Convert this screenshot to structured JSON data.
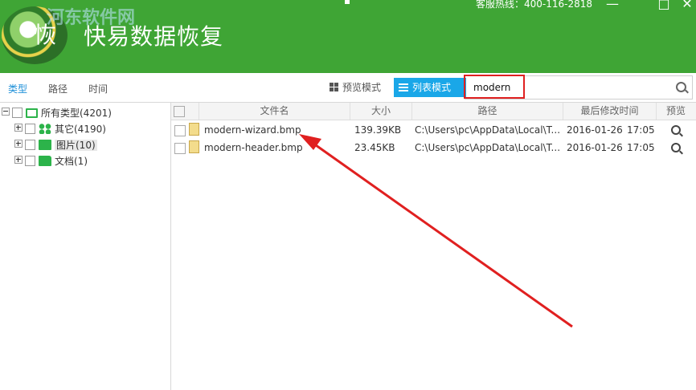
{
  "app": {
    "logo_text": "恢",
    "title": "快易数据恢复",
    "watermark": "河东软件网",
    "hotline": "客服热线：400-116-2818",
    "window_controls": [
      "—",
      "□",
      "✕"
    ]
  },
  "toolbar": {
    "tabs": [
      "类型",
      "路径",
      "时间"
    ],
    "preview_mode_label": "预览模式",
    "list_mode_label": "列表模式",
    "search_value": "modern"
  },
  "tree": {
    "root": "所有类型(4201)",
    "children": [
      "其它(4190)",
      "图片(10)",
      "文档(1)"
    ]
  },
  "table": {
    "headers": [
      "文件名",
      "大小",
      "路径",
      "最后修改时间",
      "预览"
    ],
    "rows": [
      {
        "name": "modern-wizard.bmp",
        "size": "139.39KB",
        "path": "C:\\Users\\pc\\AppData\\Local\\T...",
        "date": "2016-01-26",
        "time": "17:05"
      },
      {
        "name": "modern-header.bmp",
        "size": "23.45KB",
        "path": "C:\\Users\\pc\\AppData\\Local\\T...",
        "date": "2016-01-26",
        "time": "17:05"
      }
    ]
  },
  "colors": {
    "header_green": "#3fa535",
    "accent_blue": "#1aa7e8",
    "highlight_red": "#e02020"
  }
}
